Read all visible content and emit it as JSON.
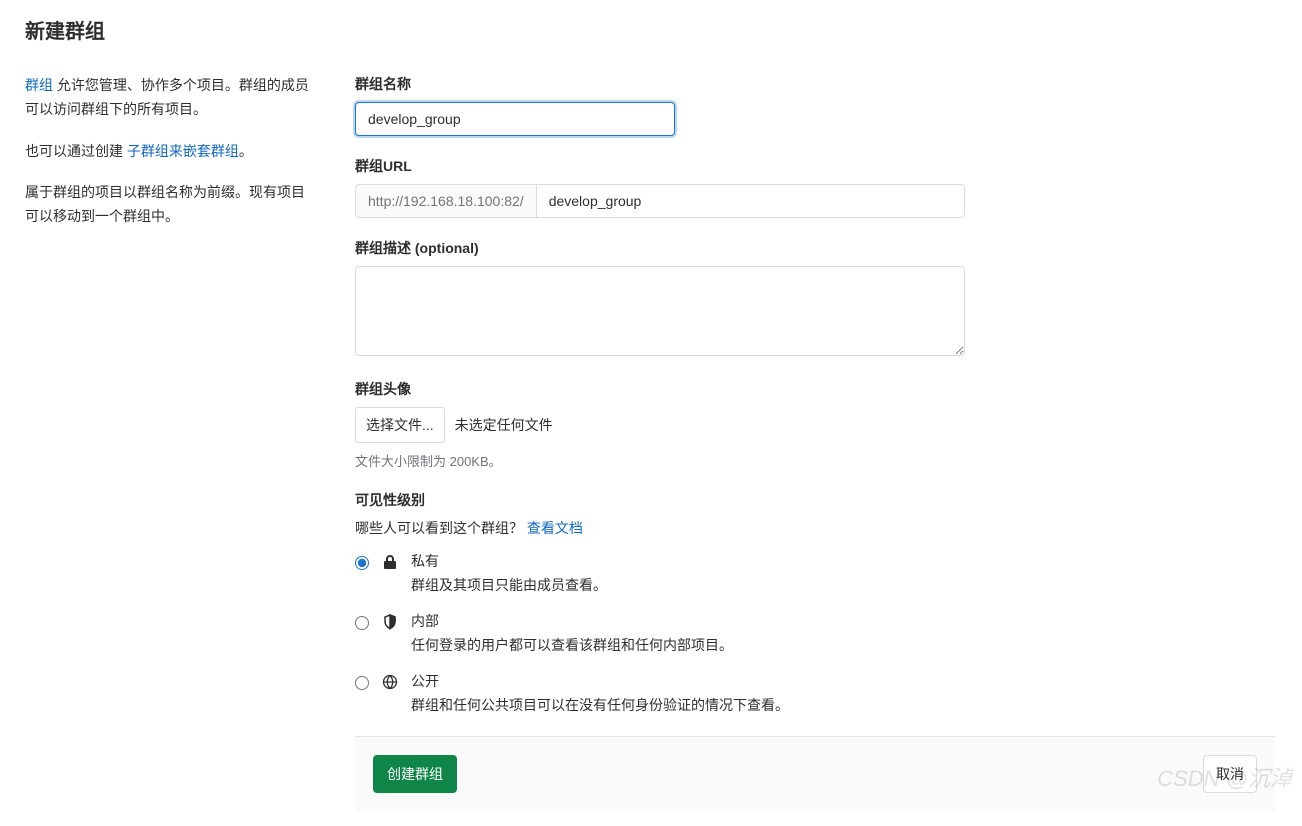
{
  "page": {
    "title": "新建群组"
  },
  "sidebar": {
    "groups_link": "群组",
    "para1_suffix": " 允许您管理、协作多个项目。群组的成员可以访问群组下的所有项目。",
    "para2_prefix": "也可以通过创建 ",
    "subgroup_link": "子群组来嵌套群组",
    "para2_suffix": "。",
    "para3": "属于群组的项目以群组名称为前缀。现有项目可以移动到一个群组中。"
  },
  "form": {
    "name_label": "群组名称",
    "name_value": "develop_group",
    "url_label": "群组URL",
    "url_prefix": "http://192.168.18.100:82/",
    "url_value": "develop_group",
    "desc_label": "群组描述 (optional)",
    "desc_value": "",
    "avatar_label": "群组头像",
    "file_btn": "选择文件...",
    "file_status": "未选定任何文件",
    "file_hint": "文件大小限制为 200KB。",
    "visibility_label": "可见性级别",
    "visibility_sub": "哪些人可以看到这个群组？ ",
    "visibility_doc_link": "查看文档",
    "options": {
      "private": {
        "title": "私有",
        "desc": "群组及其项目只能由成员查看。"
      },
      "internal": {
        "title": "内部",
        "desc": "任何登录的用户都可以查看该群组和任何内部项目。"
      },
      "public": {
        "title": "公开",
        "desc": "群组和任何公共项目可以在没有任何身份验证的情况下查看。"
      }
    }
  },
  "buttons": {
    "create": "创建群组",
    "cancel": "取消"
  },
  "watermark": "CSDN @沉淖"
}
